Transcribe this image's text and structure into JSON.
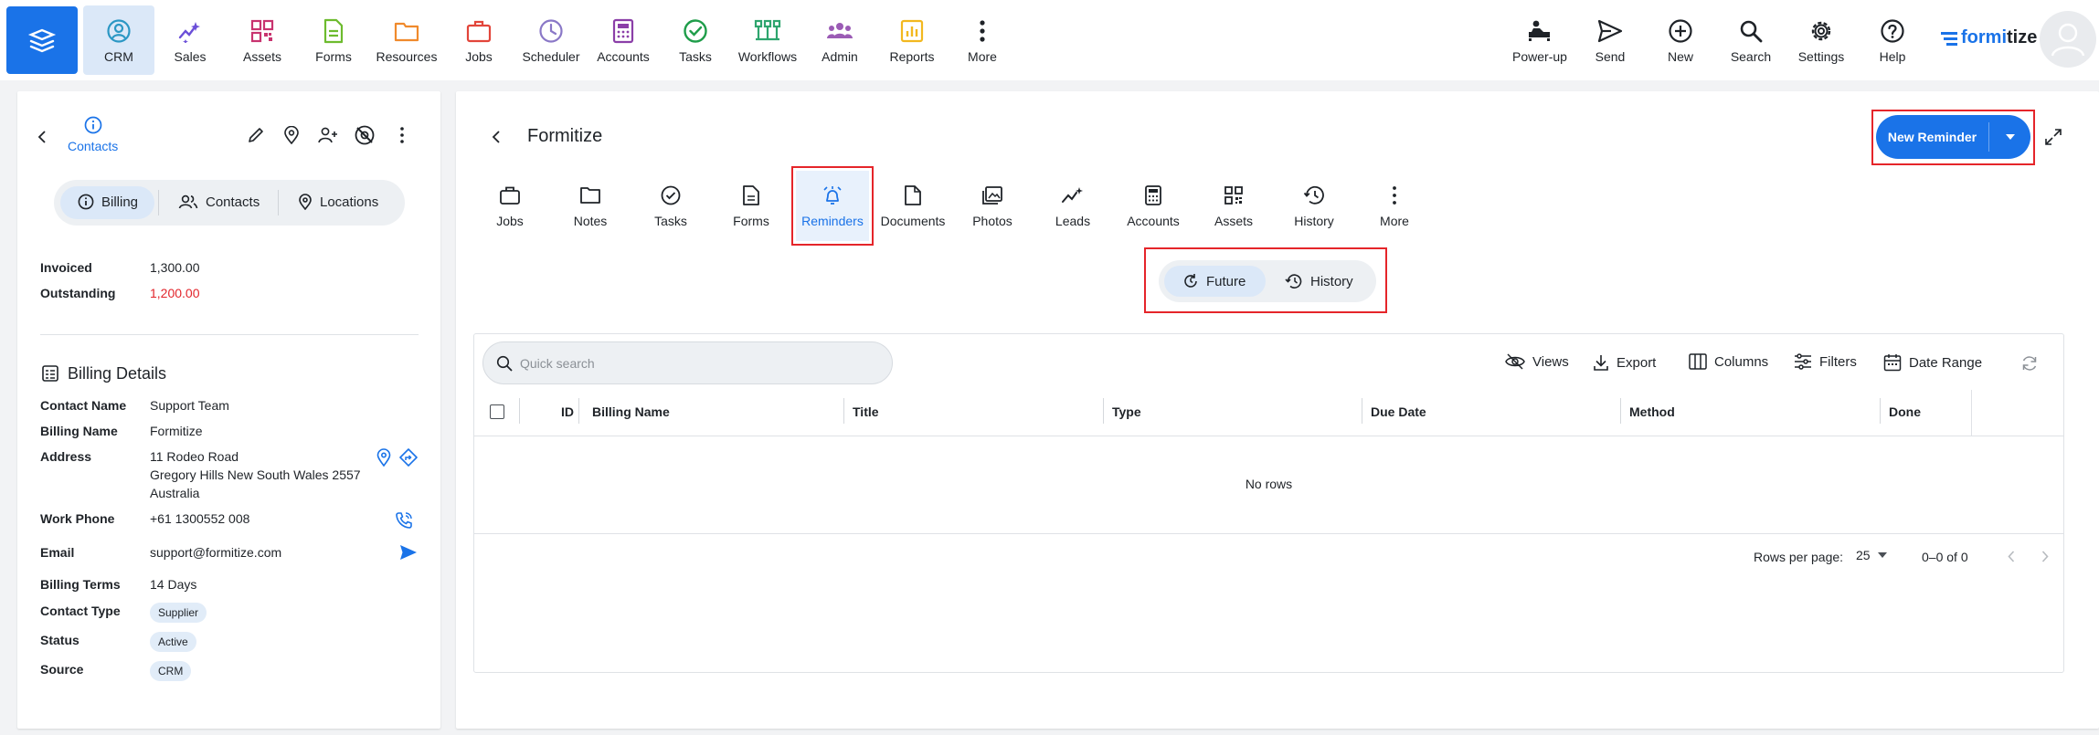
{
  "nav": {
    "items": [
      {
        "label": "CRM",
        "icon": "crm-icon",
        "color": "#2b97c4"
      },
      {
        "label": "Sales",
        "icon": "sales-icon",
        "color": "#6b4fd8"
      },
      {
        "label": "Assets",
        "icon": "assets-icon",
        "color": "#c8336f"
      },
      {
        "label": "Forms",
        "icon": "forms-icon",
        "color": "#6dbb2e"
      },
      {
        "label": "Resources",
        "icon": "resources-icon",
        "color": "#f08a2c"
      },
      {
        "label": "Jobs",
        "icon": "jobs-icon",
        "color": "#e2453a"
      },
      {
        "label": "Scheduler",
        "icon": "scheduler-icon",
        "color": "#8a78c7"
      },
      {
        "label": "Accounts",
        "icon": "accounts-icon",
        "color": "#8b3fa8"
      },
      {
        "label": "Tasks",
        "icon": "tasks-icon",
        "color": "#1f9d4a"
      },
      {
        "label": "Workflows",
        "icon": "workflows-icon",
        "color": "#2ea56e"
      },
      {
        "label": "Admin",
        "icon": "admin-icon",
        "color": "#9b5bb5"
      },
      {
        "label": "Reports",
        "icon": "reports-icon",
        "color": "#f2b81f"
      },
      {
        "label": "More",
        "icon": "more-vertical-icon",
        "color": "#1f2328"
      }
    ],
    "right": [
      {
        "label": "Power-up",
        "icon": "power-up-icon"
      },
      {
        "label": "Send",
        "icon": "send-icon"
      },
      {
        "label": "New",
        "icon": "plus-circle-icon"
      },
      {
        "label": "Search",
        "icon": "search-icon"
      },
      {
        "label": "Settings",
        "icon": "gear-icon"
      },
      {
        "label": "Help",
        "icon": "help-icon"
      }
    ],
    "logo_a": "formi",
    "logo_b": "tize"
  },
  "left": {
    "header_label": "Contacts",
    "segments": [
      "Billing",
      "Contacts",
      "Locations"
    ],
    "summary": [
      {
        "label": "Invoiced",
        "value": "1,300.00",
        "color": "#1f2328"
      },
      {
        "label": "Outstanding",
        "value": "1,200.00",
        "color": "#e2252b"
      }
    ],
    "section_title": "Billing Details",
    "fields": {
      "contact_name": {
        "label": "Contact Name",
        "value": "Support Team"
      },
      "billing_name": {
        "label": "Billing Name",
        "value": "Formitize"
      },
      "address": {
        "label": "Address",
        "line1": "11 Rodeo Road",
        "line2": "Gregory Hills New South Wales 2557",
        "line3": "Australia"
      },
      "work_phone": {
        "label": "Work Phone",
        "value": "+61 1300552 008"
      },
      "email": {
        "label": "Email",
        "value": "support@formitize.com"
      },
      "billing_terms": {
        "label": "Billing Terms",
        "value": "14 Days"
      },
      "contact_type": {
        "label": "Contact Type",
        "value": "Supplier"
      },
      "status": {
        "label": "Status",
        "value": "Active"
      },
      "source": {
        "label": "Source",
        "value": "CRM"
      }
    }
  },
  "main": {
    "title": "Formitize",
    "new_reminder": "New Reminder",
    "tabs": [
      "Jobs",
      "Notes",
      "Tasks",
      "Forms",
      "Reminders",
      "Documents",
      "Photos",
      "Leads",
      "Accounts",
      "Assets",
      "History",
      "More"
    ],
    "toggle": [
      "Future",
      "History"
    ],
    "search_placeholder": "Quick search",
    "toolbar": [
      "Views",
      "Export",
      "Columns",
      "Filters",
      "Date Range"
    ],
    "columns": [
      "ID",
      "Billing Name",
      "Title",
      "Type",
      "Due Date",
      "Method",
      "Done"
    ],
    "empty": "No rows",
    "footer": {
      "rows_per_page_label": "Rows per page:",
      "rows_per_page": "25",
      "range": "0–0 of 0"
    }
  },
  "colors": {
    "accent": "#1a73e8",
    "highlight": "#e5252a"
  }
}
